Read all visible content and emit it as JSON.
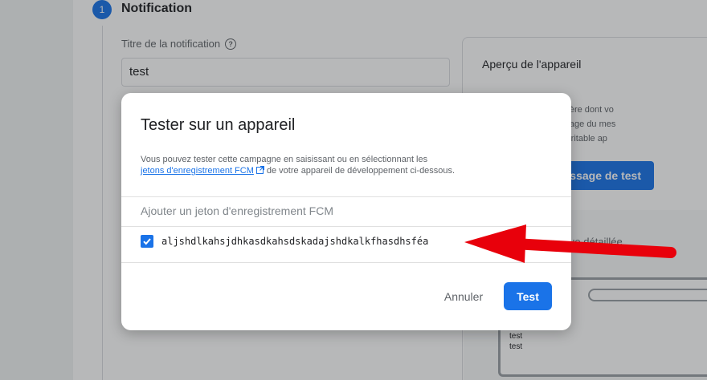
{
  "form": {
    "step_number": "1",
    "step_title": "Notification",
    "title_label": "Titre de la notification",
    "title_value": "test"
  },
  "preview": {
    "title": "Aperçu de l'appareil",
    "description": "re une idée de la manière dont vo\nppareil mobile. L'affichage du mes\nctuez un test sur un véritable ap\nuux.",
    "test_button": "ssage de test",
    "detail_label": "Vue détaillée",
    "device_lines": [
      "test",
      "test"
    ]
  },
  "dialog": {
    "title": "Tester sur un appareil",
    "desc_before": "Vous pouvez tester cette campagne en saisissant ou en sélectionnant les",
    "desc_link": "jetons d'enregistrement FCM",
    "desc_after": "de votre appareil de développement ci-dessous.",
    "token_placeholder": "Ajouter un jeton d'enregistrement FCM",
    "tokens": [
      {
        "value": "aljshdlkahsjdhkasdkahsdskadajshdkalkfhasdhsféa",
        "checked": true
      }
    ],
    "cancel_label": "Annuler",
    "test_label": "Test"
  },
  "colors": {
    "accent": "#1a73e8",
    "annotation_arrow": "#e8000b"
  }
}
